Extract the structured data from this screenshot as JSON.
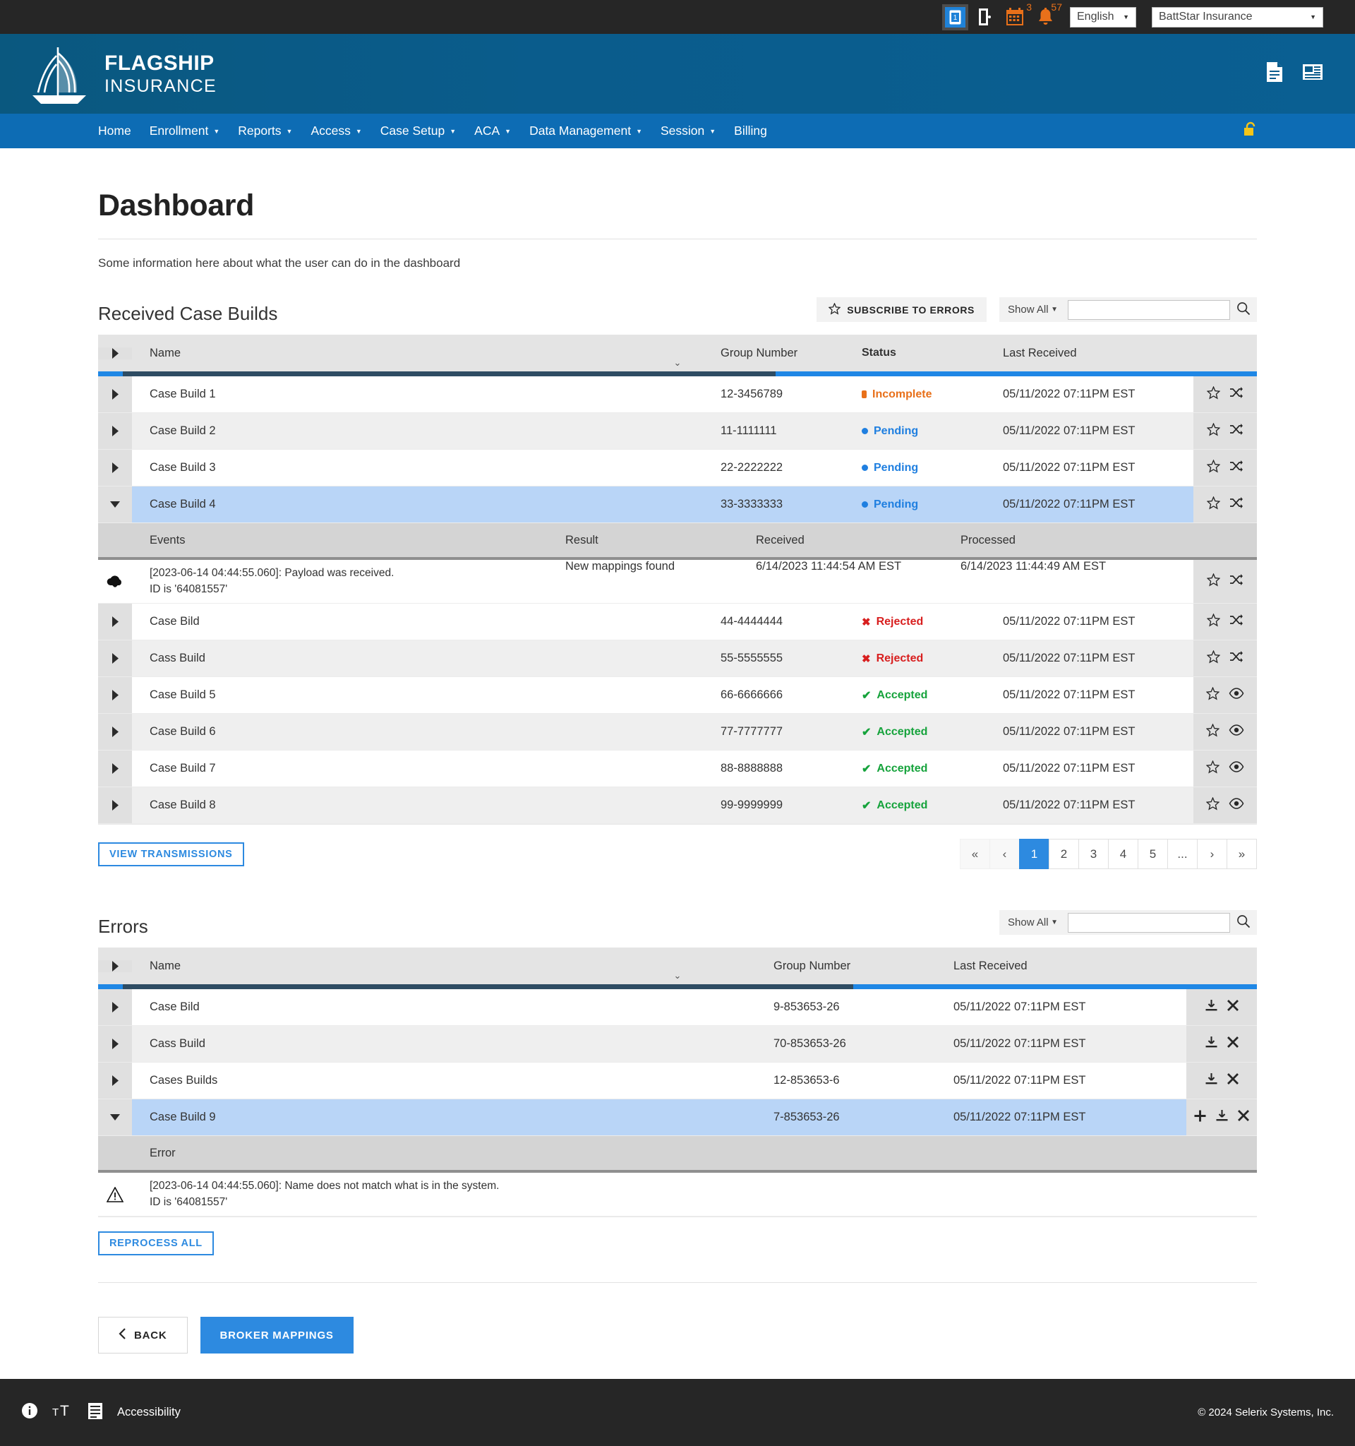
{
  "utility_bar": {
    "icons": [
      {
        "name": "id-card-icon",
        "badge": null
      },
      {
        "name": "logout-door-icon",
        "badge": null
      },
      {
        "name": "calendar-icon",
        "badge": "3"
      },
      {
        "name": "bell-icon",
        "badge": "57"
      }
    ],
    "language_select": {
      "value": "English"
    },
    "organization_select": {
      "value": "BattStar Insurance"
    }
  },
  "brand": {
    "logo_line1": "FLAGSHIP",
    "logo_line2": "INSURANCE",
    "right_icons": [
      "document-icon",
      "news-icon"
    ]
  },
  "nav": {
    "items": [
      {
        "label": "Home",
        "has_dropdown": false
      },
      {
        "label": "Enrollment",
        "has_dropdown": true
      },
      {
        "label": "Reports",
        "has_dropdown": true
      },
      {
        "label": "Access",
        "has_dropdown": true
      },
      {
        "label": "Case Setup",
        "has_dropdown": true
      },
      {
        "label": "ACA",
        "has_dropdown": true
      },
      {
        "label": "Data Management",
        "has_dropdown": true
      },
      {
        "label": "Session",
        "has_dropdown": true
      },
      {
        "label": "Billing",
        "has_dropdown": false
      }
    ],
    "lock_icon": "unlock-icon"
  },
  "page": {
    "title": "Dashboard",
    "description": "Some information here about what the user can do in the dashboard"
  },
  "received_case_builds": {
    "title": "Received Case Builds",
    "subscribe_label": "SUBSCRIBE TO ERRORS",
    "filter_value": "Show All",
    "search_value": "",
    "search_placeholder": "",
    "columns": {
      "name": "Name",
      "group_number": "Group Number",
      "status": "Status",
      "last_received": "Last Received"
    },
    "rows": [
      {
        "name": "Case Build 1",
        "group": "12-3456789",
        "status": "Incomplete",
        "status_kind": "incomplete",
        "received": "05/11/2022 07:11PM EST",
        "actions": [
          "star-icon",
          "shuffle-icon"
        ],
        "expanded": false
      },
      {
        "name": "Case Build 2",
        "group": "11-1111111",
        "status": "Pending",
        "status_kind": "pending",
        "received": "05/11/2022 07:11PM EST",
        "actions": [
          "star-icon",
          "shuffle-icon"
        ],
        "expanded": false
      },
      {
        "name": "Case Build 3",
        "group": "22-2222222",
        "status": "Pending",
        "status_kind": "pending",
        "received": "05/11/2022 07:11PM EST",
        "actions": [
          "star-icon",
          "shuffle-icon"
        ],
        "expanded": false
      },
      {
        "name": "Case Build 4",
        "group": "33-3333333",
        "status": "Pending",
        "status_kind": "pending",
        "received": "05/11/2022 07:11PM EST",
        "actions": [
          "star-icon",
          "shuffle-icon"
        ],
        "expanded": true
      },
      {
        "name": "Case Bild",
        "group": "44-4444444",
        "status": "Rejected",
        "status_kind": "rejected",
        "received": "05/11/2022 07:11PM EST",
        "actions": [
          "star-icon",
          "shuffle-icon"
        ],
        "expanded": false
      },
      {
        "name": "Cass Build",
        "group": "55-5555555",
        "status": "Rejected",
        "status_kind": "rejected",
        "received": "05/11/2022 07:11PM EST",
        "actions": [
          "star-icon",
          "shuffle-icon"
        ],
        "expanded": false
      },
      {
        "name": "Case Build 5",
        "group": "66-6666666",
        "status": "Accepted",
        "status_kind": "accepted",
        "received": "05/11/2022 07:11PM EST",
        "actions": [
          "star-icon",
          "eye-icon"
        ],
        "expanded": false
      },
      {
        "name": "Case Build 6",
        "group": "77-7777777",
        "status": "Accepted",
        "status_kind": "accepted",
        "received": "05/11/2022 07:11PM EST",
        "actions": [
          "star-icon",
          "eye-icon"
        ],
        "expanded": false
      },
      {
        "name": "Case Build 7",
        "group": "88-8888888",
        "status": "Accepted",
        "status_kind": "accepted",
        "received": "05/11/2022 07:11PM EST",
        "actions": [
          "star-icon",
          "eye-icon"
        ],
        "expanded": false
      },
      {
        "name": "Case Build 8",
        "group": "99-9999999",
        "status": "Accepted",
        "status_kind": "accepted",
        "received": "05/11/2022 07:11PM EST",
        "actions": [
          "star-icon",
          "eye-icon"
        ],
        "expanded": false
      }
    ],
    "events_subtable": {
      "columns": {
        "events": "Events",
        "result": "Result",
        "received": "Received",
        "processed": "Processed"
      },
      "rows": [
        {
          "icon": "cloud-download-icon",
          "line1": "[2023-06-14 04:44:55.060]: Payload was received.",
          "line2": "ID is '64081557'",
          "result": "New mappings found",
          "received": "6/14/2023 11:44:54 AM EST",
          "processed": "6/14/2023 11:44:49 AM EST",
          "actions": [
            "star-icon",
            "shuffle-icon"
          ]
        }
      ]
    },
    "view_transmissions_label": "VIEW TRANSMISSIONS",
    "pagination": {
      "first": "«",
      "prev": "‹",
      "next": "›",
      "last": "»",
      "pages": [
        "1",
        "2",
        "3",
        "4",
        "5",
        "..."
      ],
      "active": "1"
    }
  },
  "errors": {
    "title": "Errors",
    "filter_value": "Show All",
    "search_value": "",
    "search_placeholder": "",
    "columns": {
      "name": "Name",
      "group_number": "Group Number",
      "last_received": "Last Received"
    },
    "rows": [
      {
        "name": "Case Bild",
        "group": "9-853653-26",
        "received": "05/11/2022 07:11PM EST",
        "actions": [
          "download-icon",
          "close-icon"
        ],
        "expanded": false
      },
      {
        "name": "Cass Build",
        "group": "70-853653-26",
        "received": "05/11/2022 07:11PM EST",
        "actions": [
          "download-icon",
          "close-icon"
        ],
        "expanded": false
      },
      {
        "name": "Cases Builds",
        "group": "12-853653-6",
        "received": "05/11/2022 07:11PM EST",
        "actions": [
          "download-icon",
          "close-icon"
        ],
        "expanded": false
      },
      {
        "name": "Case Build 9",
        "group": "7-853653-26",
        "received": "05/11/2022 07:11PM EST",
        "actions": [
          "plus-icon",
          "download-icon",
          "close-icon"
        ],
        "expanded": true
      }
    ],
    "error_subtable": {
      "column": "Error",
      "rows": [
        {
          "icon": "warning-icon",
          "line1": "[2023-06-14 04:44:55.060]: Name does not match what is in the system.",
          "line2": "ID is '64081557'"
        }
      ]
    },
    "reprocess_label": "REPROCESS ALL"
  },
  "footer_actions": {
    "back_label": "BACK",
    "broker_mappings_label": "BROKER MAPPINGS"
  },
  "site_footer": {
    "icons": [
      "info-icon",
      "text-size-icon",
      "document-icon"
    ],
    "accessibility_label": "Accessibility",
    "copyright": "© 2024 Selerix Systems, Inc."
  },
  "colors": {
    "brand_header": "#0a5c8c",
    "nav": "#0d6cb4",
    "accent": "#2d8ae0",
    "orange": "#e8701a",
    "green": "#16a33c",
    "red": "#d81f1f",
    "selected_row": "#b9d5f7"
  }
}
